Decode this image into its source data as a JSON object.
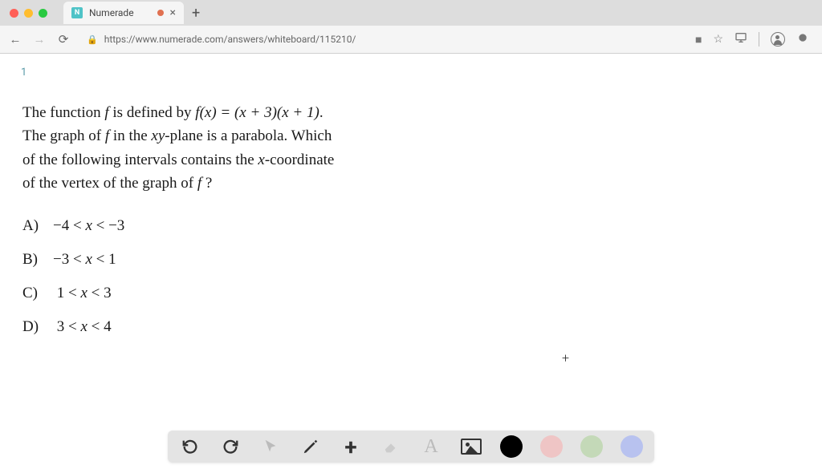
{
  "browser": {
    "tab_title": "Numerade",
    "favicon_letter": "N",
    "url": "https://www.numerade.com/answers/whiteboard/115210/"
  },
  "page": {
    "number": "1",
    "question_line1_pre": "The function ",
    "question_line1_f": "f",
    "question_line1_mid": " is defined by ",
    "question_line1_fx": "f(x) = (x + 3)(x + 1)",
    "question_line1_post": ".",
    "question_line2_pre": "The graph of ",
    "question_line2_f": "f",
    "question_line2_mid": " in the ",
    "question_line2_xy": "xy",
    "question_line2_post": "-plane is a parabola. Which",
    "question_line3": "of the following intervals contains the ",
    "question_line3_x": "x",
    "question_line3_post": "-coordinate",
    "question_line4_pre": "of the vertex of the graph of ",
    "question_line4_f": "f",
    "question_line4_post": " ?",
    "options": [
      {
        "label": "A)",
        "pre": "−4 < ",
        "var": "x",
        "post": " < −3"
      },
      {
        "label": "B)",
        "pre": "−3 < ",
        "var": "x",
        "post": " < 1"
      },
      {
        "label": "C)",
        "pre": "1 < ",
        "var": "x",
        "post": " < 3"
      },
      {
        "label": "D)",
        "pre": "3 < ",
        "var": "x",
        "post": " < 4"
      }
    ]
  },
  "toolbar": {
    "colors": {
      "black": "#000000",
      "pink": "#efc5c5",
      "green": "#c4d9b8",
      "blue": "#b8c2ef"
    }
  }
}
